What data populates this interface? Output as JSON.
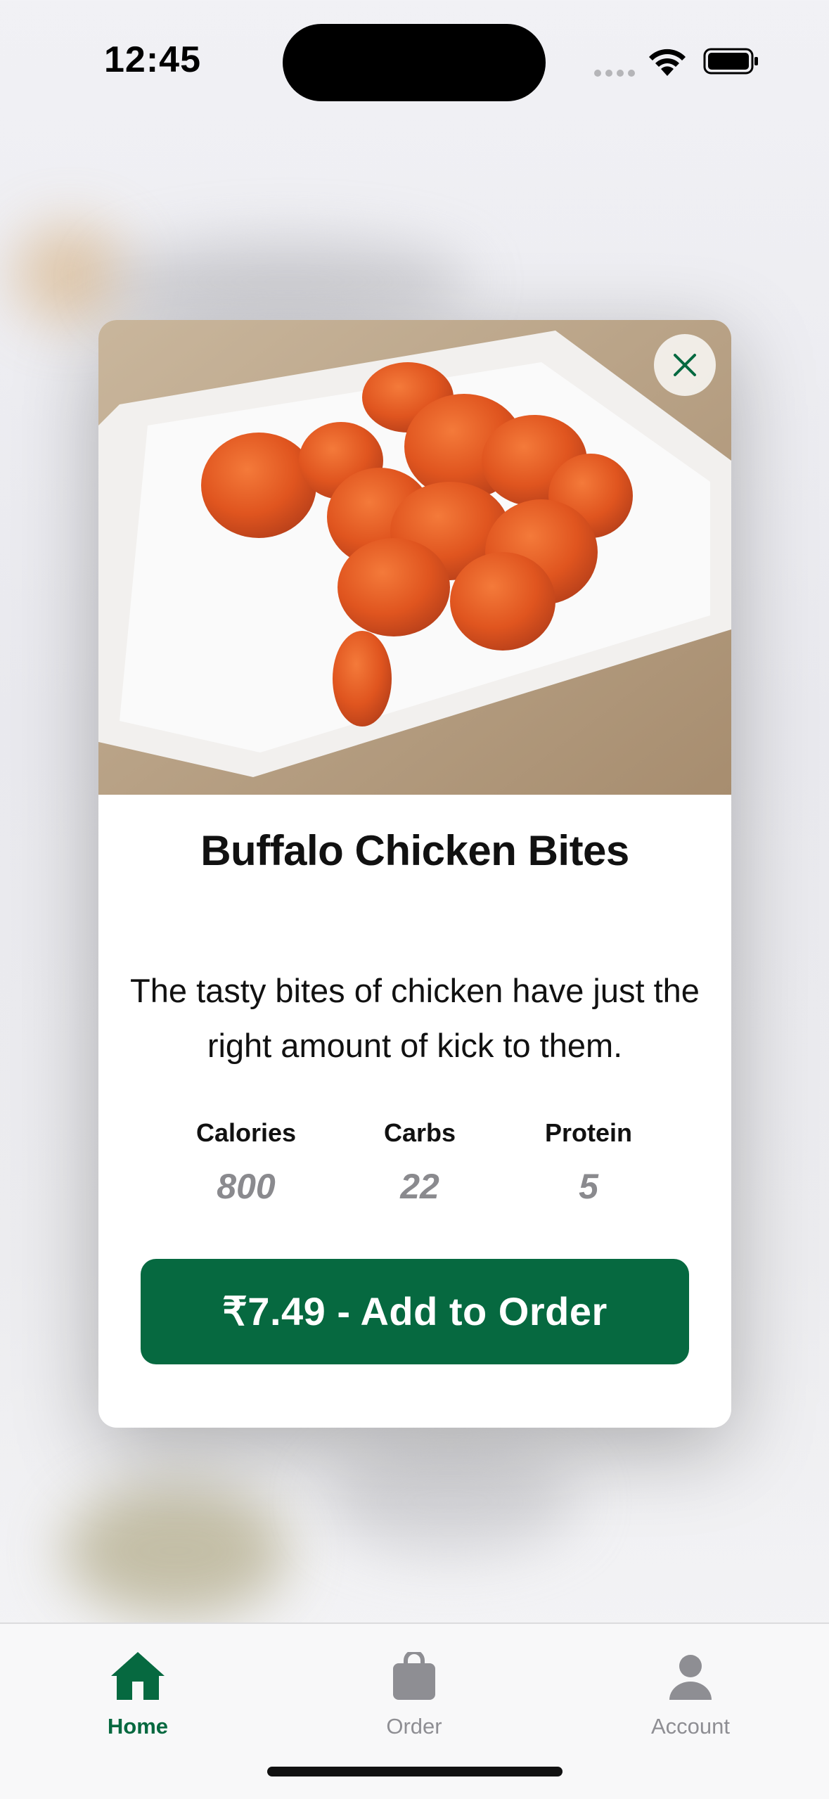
{
  "status_bar": {
    "time": "12:45"
  },
  "item": {
    "title": "Buffalo Chicken Bites",
    "description": "The tasty bites of chicken have just the right amount of kick to them.",
    "nutrition": [
      {
        "label": "Calories",
        "value": "800"
      },
      {
        "label": "Carbs",
        "value": "22"
      },
      {
        "label": "Protein",
        "value": "5"
      }
    ],
    "add_button_label": "₹7.49 - Add to Order"
  },
  "tabs": [
    {
      "label": "Home",
      "icon": "home-icon",
      "active": true
    },
    {
      "label": "Order",
      "icon": "bag-icon",
      "active": false
    },
    {
      "label": "Account",
      "icon": "person-icon",
      "active": false
    }
  ],
  "colors": {
    "brand_green": "#066940",
    "inactive_gray": "#8e8e93"
  }
}
